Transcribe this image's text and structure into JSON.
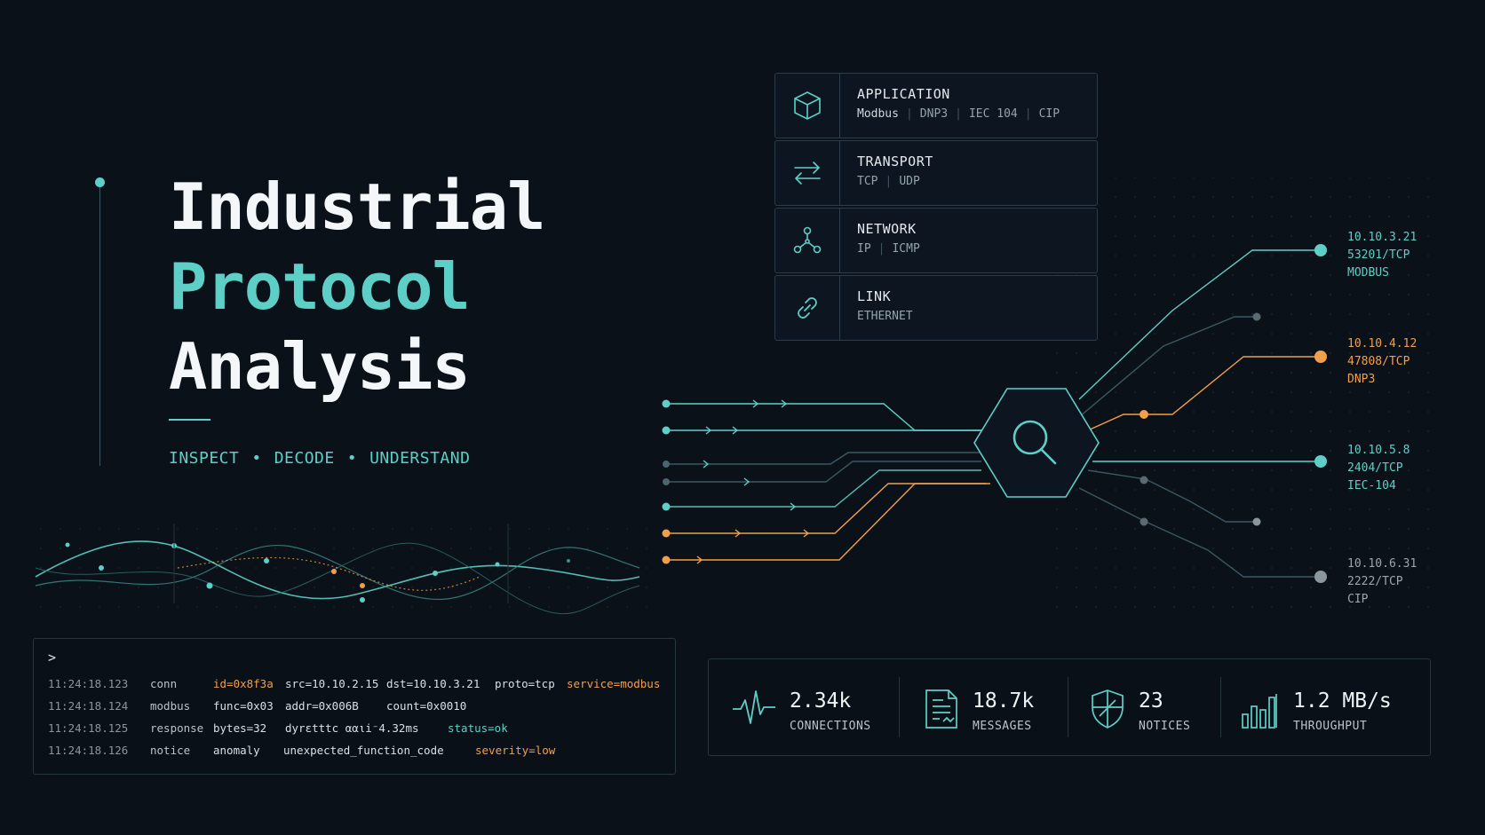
{
  "hero": {
    "title_line1": "Industrial",
    "title_line2": "Protocol",
    "title_line3": "Analysis",
    "tagline": [
      "INSPECT",
      "DECODE",
      "UNDERSTAND"
    ],
    "tagline_sep": "•"
  },
  "stack": [
    {
      "name": "APPLICATION",
      "icon": "cube-icon",
      "protocols": [
        "Modbus",
        "DNP3",
        "IEC 104",
        "CIP"
      ]
    },
    {
      "name": "TRANSPORT",
      "icon": "arrows-exchange-icon",
      "protocols": [
        "TCP",
        "UDP"
      ]
    },
    {
      "name": "NETWORK",
      "icon": "network-nodes-icon",
      "protocols": [
        "IP",
        "ICMP"
      ]
    },
    {
      "name": "LINK",
      "icon": "link-chain-icon",
      "protocols": [
        "ETHERNET"
      ]
    }
  ],
  "proto_sep": "|",
  "endpoints": [
    {
      "ip": "10.10.3.21",
      "port": "53201/TCP",
      "proto": "MODBUS"
    },
    {
      "ip": "10.10.4.12",
      "port": "47808/TCP",
      "proto": "DNP3"
    },
    {
      "ip": "10.10.5.8",
      "port": "2404/TCP",
      "proto": "IEC-104"
    },
    {
      "ip": "10.10.6.31",
      "port": "2222/TCP",
      "proto": "CIP"
    }
  ],
  "colors": {
    "teal": "#5ecfc7",
    "orange": "#f0a04b",
    "grey": "#8a969d",
    "background": "#0b1118"
  },
  "hub_icon": "magnifier-icon",
  "terminal": {
    "prompt": ">",
    "rows": [
      {
        "ts": "11:24:18.123",
        "event": "conn",
        "f1": "id=0x8f3a",
        "f2": "src=10.10.2.15",
        "f3": "dst=10.10.3.21",
        "f4": "proto=tcp",
        "f5": "service=modbus"
      },
      {
        "ts": "11:24:18.124",
        "event": "modbus",
        "f1": "func=0x03",
        "f2": "addr=0x006B",
        "f3": "count=0x0010"
      },
      {
        "ts": "11:24:18.125",
        "event": "response",
        "f1": "bytes=32",
        "f2": "dyrεtttc ααιi⁻4.32ms",
        "f3": "status=ok"
      },
      {
        "ts": "11:24:18.126",
        "event": "notice",
        "f1": "anomaly",
        "f2": "unexpected_function_code",
        "f3": "severity=low"
      }
    ]
  },
  "stats": [
    {
      "value": "2.34k",
      "label": "CONNECTIONS",
      "icon": "pulse-icon"
    },
    {
      "value": "18.7k",
      "label": "MESSAGES",
      "icon": "document-icon"
    },
    {
      "value": "23",
      "label": "NOTICES",
      "icon": "shield-icon"
    },
    {
      "value": "1.2 MB/s",
      "label": "THROUGHPUT",
      "icon": "bar-chart-icon"
    }
  ]
}
